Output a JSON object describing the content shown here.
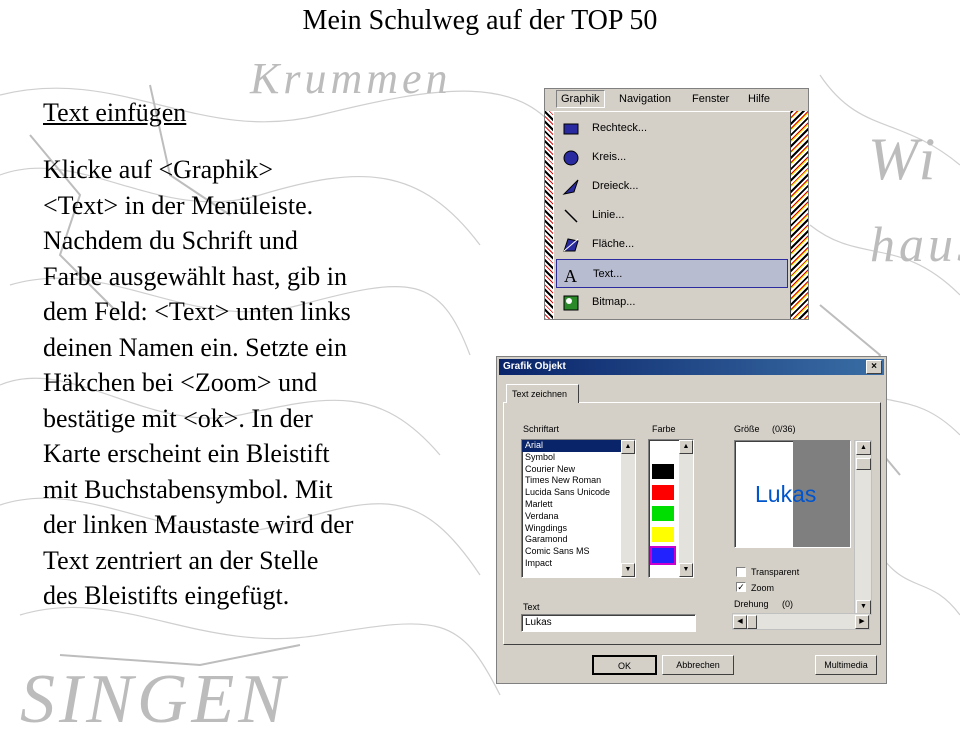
{
  "page_title": "Mein Schulweg auf der TOP 50",
  "section_heading": "Text einfügen",
  "instructions": [
    "Klicke auf <Graphik>",
    "<Text> in der Menüleiste.",
    "Nachdem du Schrift und",
    "Farbe ausgewählt hast, gib in",
    "dem Feld: <Text> unten links",
    "deinen Namen ein. Setzte ein",
    "Häkchen bei <Zoom> und",
    "bestätige mit <ok>. In der",
    "Karte erscheint ein Bleistift",
    "mit Buchstabensymbol. Mit",
    "der linken Maustaste wird der",
    "Text zentriert an der Stelle",
    "des Bleistifts eingefügt."
  ],
  "map_words": [
    "Krummen",
    "Wi",
    "haus",
    "SINGEN"
  ],
  "menu": {
    "bar": [
      "Graphik",
      "Navigation",
      "Fenster",
      "Hilfe"
    ],
    "items": [
      {
        "label": "Rechteck...",
        "icon": "rectangle-icon"
      },
      {
        "label": "Kreis...",
        "icon": "circle-icon"
      },
      {
        "label": "Dreieck...",
        "icon": "triangle-icon"
      },
      {
        "label": "Linie...",
        "icon": "line-icon"
      },
      {
        "label": "Fläche...",
        "icon": "area-icon"
      },
      {
        "label": "Text...",
        "icon": "text-icon",
        "selected": true
      },
      {
        "label": "Bitmap...",
        "icon": "bitmap-icon"
      }
    ]
  },
  "dialog": {
    "title": "Grafik Objekt",
    "close": "×",
    "tab": "Text zeichnen",
    "font_label": "Schriftart",
    "fonts": [
      "Arial",
      "Symbol",
      "Courier New",
      "Times New Roman",
      "Lucida Sans Unicode",
      "Marlett",
      "Verdana",
      "Wingdings",
      "Garamond",
      "Comic Sans MS",
      "Impact"
    ],
    "selected_font": "Arial",
    "color_label": "Farbe",
    "colors": [
      "#ffffff",
      "#000000",
      "#ff0000",
      "#00dd00",
      "#ffff00",
      "#2222ff"
    ],
    "size_label": "Größe",
    "size_value": "(0/36)",
    "preview_text": "Lukas",
    "transparent_label": "Transparent",
    "transparent_checked": false,
    "zoom_label": "Zoom",
    "zoom_checked": true,
    "rotation_label": "Drehung",
    "rotation_value": "(0)",
    "text_label": "Text",
    "text_value": "Lukas",
    "ok": "OK",
    "cancel": "Abbrechen",
    "multimedia": "Multimedia"
  }
}
